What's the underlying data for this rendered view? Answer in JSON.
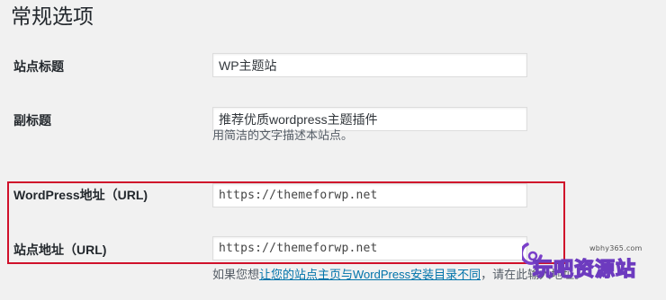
{
  "page": {
    "title": "常规选项"
  },
  "fields": {
    "site_title": {
      "label": "站点标题",
      "value": "WP主题站"
    },
    "tagline": {
      "label": "副标题",
      "value": "推荐优质wordpress主题插件",
      "description": "用简洁的文字描述本站点。"
    },
    "wp_address": {
      "label": "WordPress地址（URL)",
      "value": "https://themeforwp.net"
    },
    "site_address": {
      "label": "站点地址（URL)",
      "value": "https://themeforwp.net",
      "description_prefix": "如果您想",
      "description_link": "让您的站点主页与WordPress安装目录不同",
      "description_suffix": "，请在此输入地址。"
    }
  },
  "watermark": {
    "site": "wbhy365.com",
    "text": "玩吧资源站"
  },
  "colors": {
    "highlight": "#d0112b",
    "link": "#0073aa",
    "background": "#f1f1f1"
  }
}
